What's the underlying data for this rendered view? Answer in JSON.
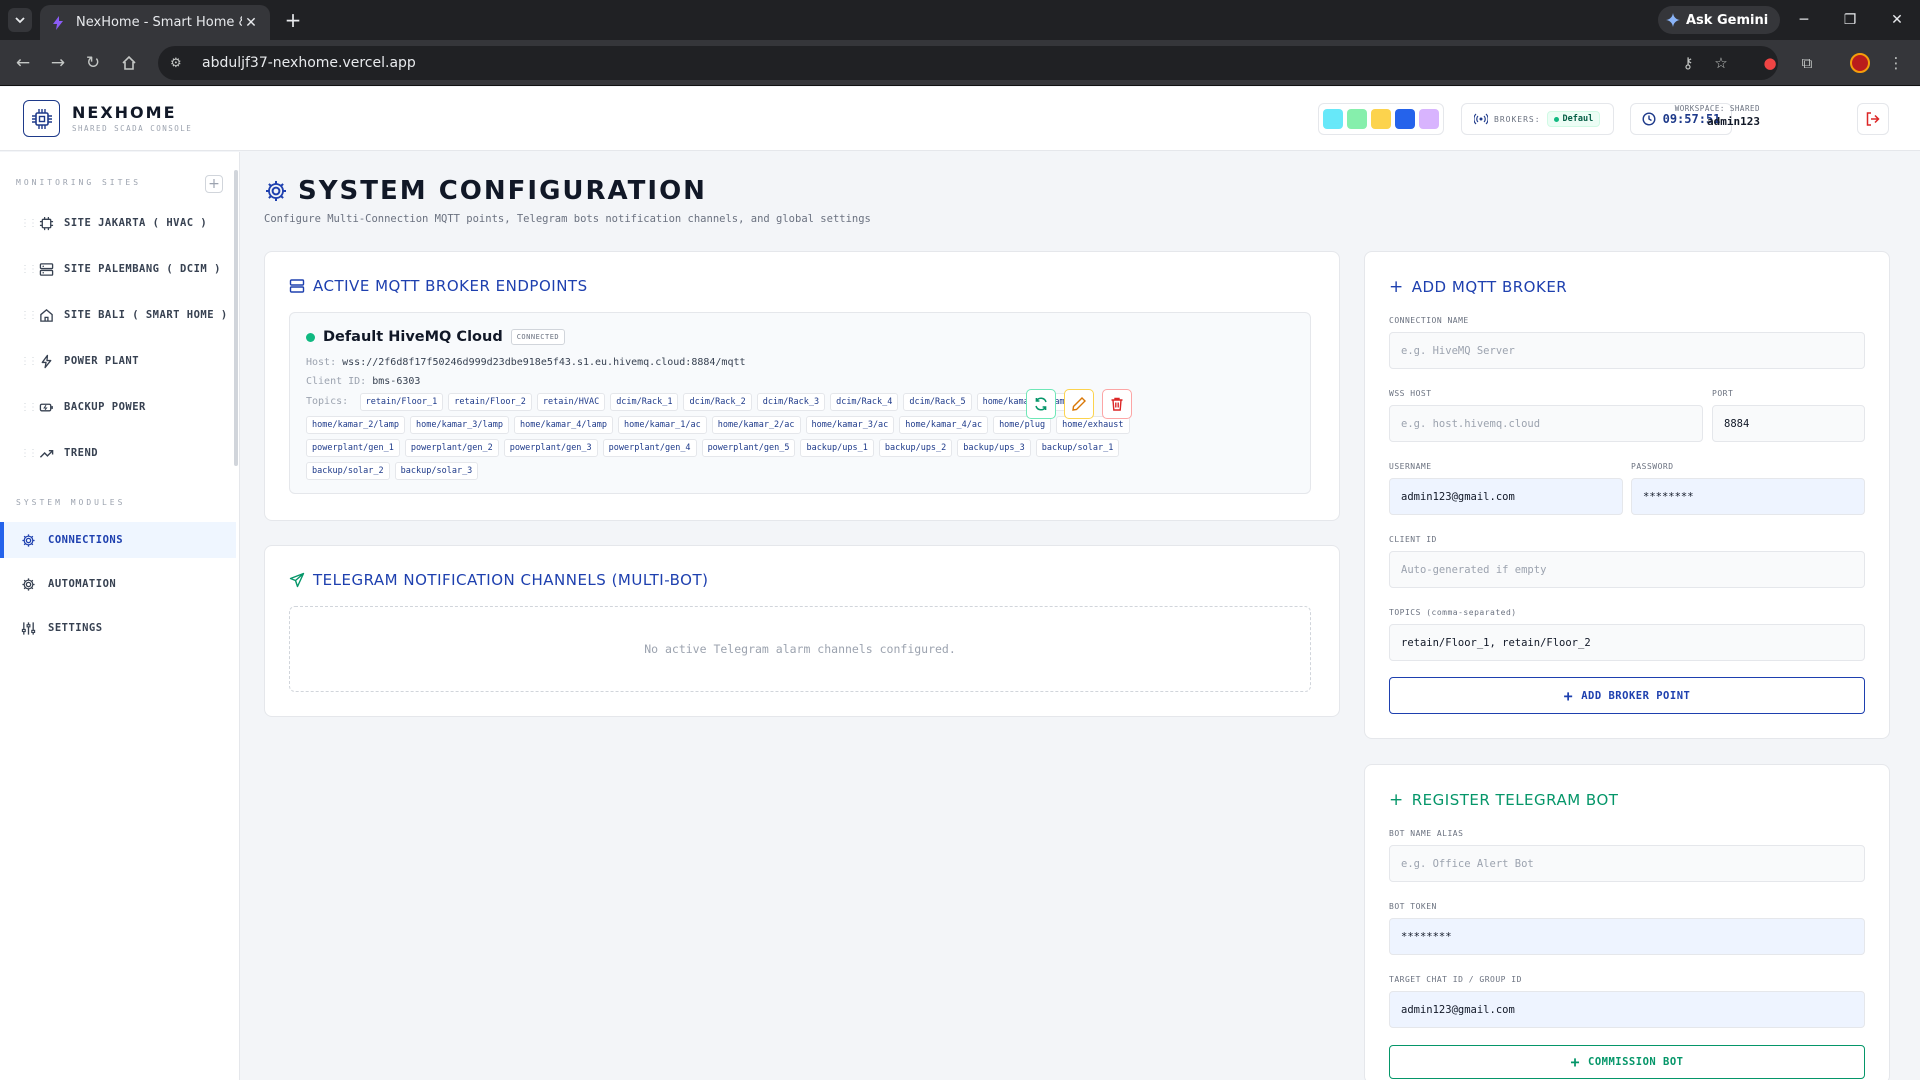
{
  "browser": {
    "tab_title": "NexHome - Smart Home & SCADA",
    "url": "abduljf37-nexhome.vercel.app",
    "ask_gemini": "Ask Gemini"
  },
  "header": {
    "brand": "NEXHOME",
    "brand_sub": "SHARED SCADA CONSOLE",
    "theme_swatches": [
      "#67e8f9",
      "#86efac",
      "#fcd34d",
      "#2563eb",
      "#d8b4fe"
    ],
    "brokers_label": "BROKERS:",
    "broker_pill": "Defaul",
    "clock": "09:57:51",
    "workspace_label": "WORKSPACE: SHARED",
    "username": "admin123"
  },
  "sidebar": {
    "sites_label": "MONITORING SITES",
    "sites": [
      {
        "label": "SITE JAKARTA ( HVAC )",
        "icon": "chip-icon"
      },
      {
        "label": "SITE PALEMBANG ( DCIM )",
        "icon": "server-icon"
      },
      {
        "label": "SITE BALI ( SMART HOME )",
        "icon": "home-icon"
      },
      {
        "label": "POWER PLANT",
        "icon": "bolt-icon"
      },
      {
        "label": "BACKUP POWER",
        "icon": "battery-icon"
      },
      {
        "label": "TREND",
        "icon": "trend-icon"
      }
    ],
    "modules_label": "SYSTEM MODULES",
    "modules": [
      {
        "label": "CONNECTIONS",
        "icon": "gear-icon"
      },
      {
        "label": "AUTOMATION",
        "icon": "cog-icon"
      },
      {
        "label": "SETTINGS",
        "icon": "sliders-icon"
      }
    ]
  },
  "page": {
    "title": "SYSTEM CONFIGURATION",
    "subtitle": "Configure Multi-Connection MQTT points, Telegram bots notification channels, and global settings"
  },
  "brokers_card": {
    "title": "ACTIVE MQTT BROKER ENDPOINTS",
    "broker": {
      "name": "Default HiveMQ Cloud",
      "status": "CONNECTED",
      "host_label": "Host:",
      "host": "wss://2f6d8f17f50246d999d23dbe918e5f43.s1.eu.hivemq.cloud:8884/mqtt",
      "client_label": "Client ID:",
      "client_id": "bms-6303",
      "topics_label": "Topics:",
      "topics": [
        "retain/Floor_1",
        "retain/Floor_2",
        "retain/HVAC",
        "dcim/Rack_1",
        "dcim/Rack_2",
        "dcim/Rack_3",
        "dcim/Rack_4",
        "dcim/Rack_5",
        "home/kamar_1/lamp",
        "home/kamar_2/lamp",
        "home/kamar_3/lamp",
        "home/kamar_4/lamp",
        "home/kamar_1/ac",
        "home/kamar_2/ac",
        "home/kamar_3/ac",
        "home/kamar_4/ac",
        "home/plug",
        "home/exhaust",
        "powerplant/gen_1",
        "powerplant/gen_2",
        "powerplant/gen_3",
        "powerplant/gen_4",
        "powerplant/gen_5",
        "backup/ups_1",
        "backup/ups_2",
        "backup/ups_3",
        "backup/solar_1",
        "backup/solar_2",
        "backup/solar_3"
      ]
    }
  },
  "telegram_card": {
    "title": "TELEGRAM NOTIFICATION CHANNELS (MULTI-BOT)",
    "empty": "No active Telegram alarm channels configured."
  },
  "add_broker": {
    "title": "ADD MQTT BROKER",
    "connection_name_label": "CONNECTION NAME",
    "connection_name_placeholder": "e.g. HiveMQ Server",
    "wss_host_label": "WSS HOST",
    "wss_host_placeholder": "e.g. host.hivemq.cloud",
    "port_label": "PORT",
    "port_value": "8884",
    "username_label": "USERNAME",
    "username_value": "admin123@gmail.com",
    "password_label": "PASSWORD",
    "password_value": "********",
    "client_id_label": "CLIENT ID",
    "client_id_placeholder": "Auto-generated if empty",
    "topics_label": "TOPICS (comma-separated)",
    "topics_value": "retain/Floor_1, retain/Floor_2",
    "button": "ADD BROKER POINT"
  },
  "register_bot": {
    "title": "REGISTER TELEGRAM BOT",
    "alias_label": "BOT NAME ALIAS",
    "alias_placeholder": "e.g. Office Alert Bot",
    "token_label": "BOT TOKEN",
    "token_value": "********",
    "chat_label": "TARGET CHAT ID / GROUP ID",
    "chat_value": "admin123@gmail.com",
    "button": "COMMISSION BOT"
  }
}
